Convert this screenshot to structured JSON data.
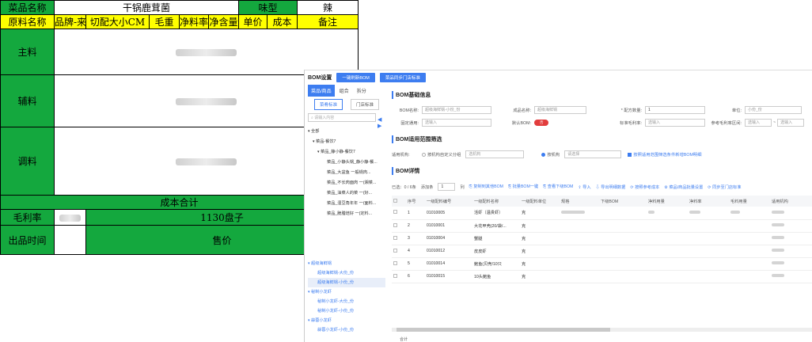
{
  "sheet": {
    "dish_label": "菜品名称",
    "dish_name": "干锅鹿茸菌",
    "flavor_label": "味型",
    "flavor_value": "辣",
    "headers": [
      "原料名称",
      "品牌-来",
      "切配大小CM",
      "毛重",
      "净料率",
      "净含量",
      "单价",
      "成本",
      "备注"
    ],
    "sections": [
      "主料",
      "辅料",
      "调料"
    ],
    "cost_total": "成本合计",
    "margin_label": "毛利率",
    "portion": "1130盘子",
    "serve_time_label": "出品时间",
    "price_label": "售价"
  },
  "app": {
    "title": "BOM设置",
    "btn_one_key": "一键刷新BOM",
    "btn_copy": "菜品同步门店标准",
    "tabs": [
      "菜品/商品",
      "组合",
      "拆分"
    ],
    "subtabs": [
      "菜肴标准",
      "门店标准"
    ],
    "search_placeholder": "请输入内容",
    "tree": [
      "全部",
      "菜品-餐饮7",
      "菜品_静小静-餐饮7",
      "菜品_小静头锅_静小静-餐...",
      "菜品_大盆鱼 一般锅肉...",
      "菜品_不长肉面肉 一(湘菜...",
      "菜品_油菜人的菜 一(好...",
      "菜品_湿豆角年年 一(面料...",
      "菜品_脆腊焙好 一(定料..."
    ],
    "variants": [
      {
        "name": "超级海鲜锅",
        "subs": [
          "超级海鲜锅-大份_份",
          "超级海鲜锅-小份_份"
        ]
      },
      {
        "name": "秘制小龙虾",
        "subs": [
          "秘制小龙虾-大份_份",
          "秘制小龙虾-小份_份"
        ]
      },
      {
        "name": "蒜蓉小龙虾",
        "subs": [
          "蒜蓉小龙虾-小份_份"
        ]
      }
    ],
    "basic_title": "BOM基础信息",
    "bom_name_label": "BOM名称:",
    "bom_name_value": "超级海鲜锅-小份_份",
    "dish_name_label": "成品名称:",
    "dish_name_value": "超级海鲜锅",
    "qty_label": "* 配方数量:",
    "qty_value": "1",
    "unit_label": "单位:",
    "unit_value": "小份_份",
    "standard_label": "固定通用:",
    "standard_placeholder": "选输入",
    "default_bom_label": "默认BOM:",
    "default_bom_toggle": "否",
    "std_margin_label": "标准毛利率:",
    "std_margin_placeholder": "选输入",
    "ref_range_label": "参考毛利率区间:",
    "ref_range_from": "选输入",
    "ref_range_to": "选输入",
    "scope_title": "BOM适用范围筛选",
    "scope_label": "适用机构:",
    "scope_radio1": "按机构自定义分组",
    "scope_select": "选机构",
    "scope_radio2": "按机构",
    "scope_select2": "请选择",
    "scope_check": "按照适用范围筛选条件新增BOM明细",
    "detail_title": "BOM详情",
    "selected": "已选：0 / 6条",
    "add_rows_label": "添加条",
    "add_rows_value": "1",
    "add_rows_unit": "列",
    "toolbar": [
      "复制到其他BOM",
      "批量BOM一键",
      "查看下级BOM",
      "导入",
      "导出明细数据",
      "按照参考成本",
      "菜品/商品批量设置",
      "同步至门店标准"
    ],
    "columns": [
      "序号",
      "一级配料编号",
      "一级配料名称",
      "一级配料单位",
      "规格",
      "下级BOM",
      "净料用量",
      "净料率",
      "毛料用量",
      "适用机构"
    ],
    "rows": [
      {
        "no": "1",
        "code": "01010005",
        "name": "活虾（温贵虾）",
        "unit": "克"
      },
      {
        "no": "2",
        "code": "01010001",
        "name": "大花甲壳(20/袋/...",
        "unit": "克"
      },
      {
        "no": "3",
        "code": "01010004",
        "name": "蟹腿",
        "unit": "克"
      },
      {
        "no": "4",
        "code": "01010012",
        "name": "皮皮虾",
        "unit": "克"
      },
      {
        "no": "5",
        "code": "01010014",
        "name": "鲍鱼(贝壳/10只",
        "unit": "克"
      },
      {
        "no": "6",
        "code": "01010015",
        "name": "10头鲍鱼",
        "unit": "克"
      }
    ],
    "total_label": "合计"
  }
}
